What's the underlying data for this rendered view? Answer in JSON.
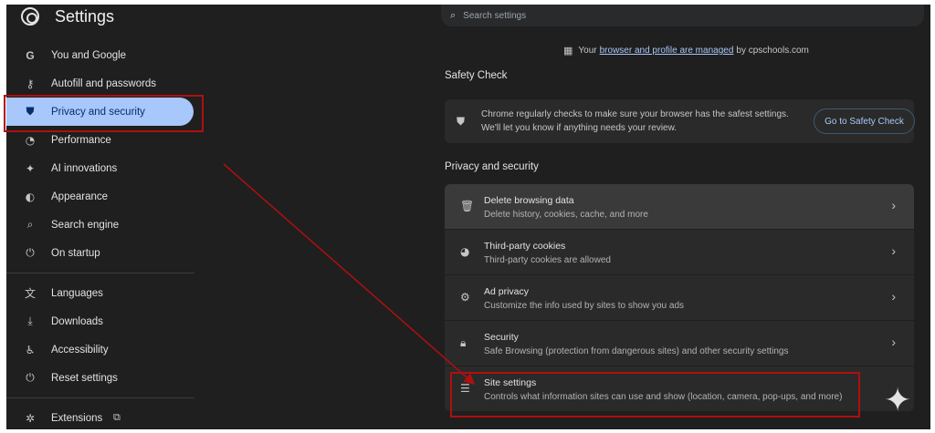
{
  "app": {
    "title": "Settings",
    "logo_icon": "chrome-icon"
  },
  "search": {
    "placeholder": "Search settings",
    "icon": "search-icon"
  },
  "sidebar": {
    "items": [
      {
        "label": "You and Google",
        "icon": "google-icon"
      },
      {
        "label": "Autofill and passwords",
        "icon": "key-icon"
      },
      {
        "label": "Privacy and security",
        "icon": "shield-icon",
        "active": true
      },
      {
        "label": "Performance",
        "icon": "speedometer-icon"
      },
      {
        "label": "AI innovations",
        "icon": "sparkle-icon"
      },
      {
        "label": "Appearance",
        "icon": "palette-icon"
      },
      {
        "label": "Search engine",
        "icon": "search-icon"
      },
      {
        "label": "On startup",
        "icon": "power-icon"
      },
      {
        "label": "Languages",
        "icon": "translate-icon"
      },
      {
        "label": "Downloads",
        "icon": "download-icon"
      },
      {
        "label": "Accessibility",
        "icon": "accessibility-icon"
      },
      {
        "label": "Reset settings",
        "icon": "reset-icon"
      },
      {
        "label": "Extensions",
        "icon": "extensions-icon"
      }
    ]
  },
  "managed": {
    "prefix": "Your",
    "link": "browser and profile are managed",
    "suffix": "by cpschools.com",
    "icon": "building-icon"
  },
  "safety_check": {
    "heading": "Safety Check",
    "line1": "Chrome regularly checks to make sure your browser has the safest settings.",
    "line2": "We'll let you know if anything needs your review.",
    "button": "Go to Safety Check",
    "icon": "shield-icon"
  },
  "privacy": {
    "heading": "Privacy and security",
    "rows": [
      {
        "title": "Delete browsing data",
        "sub": "Delete history, cookies, cache, and more",
        "icon": "trash-icon"
      },
      {
        "title": "Third-party cookies",
        "sub": "Third-party cookies are allowed",
        "icon": "cookie-icon"
      },
      {
        "title": "Ad privacy",
        "sub": "Customize the info used by sites to show you ads",
        "icon": "ad-privacy-icon"
      },
      {
        "title": "Security",
        "sub": "Safe Browsing (protection from dangerous sites) and other security settings",
        "icon": "lock-icon"
      },
      {
        "title": "Site settings",
        "sub": "Controls what information sites can use and show (location, camera, pop-ups, and more)",
        "icon": "sliders-icon"
      }
    ]
  },
  "colors": {
    "background": "#1f1f1f",
    "active_nav": "#a8c7fa",
    "accent_link": "#a8c7fa",
    "annotation": "#b00f0f"
  }
}
